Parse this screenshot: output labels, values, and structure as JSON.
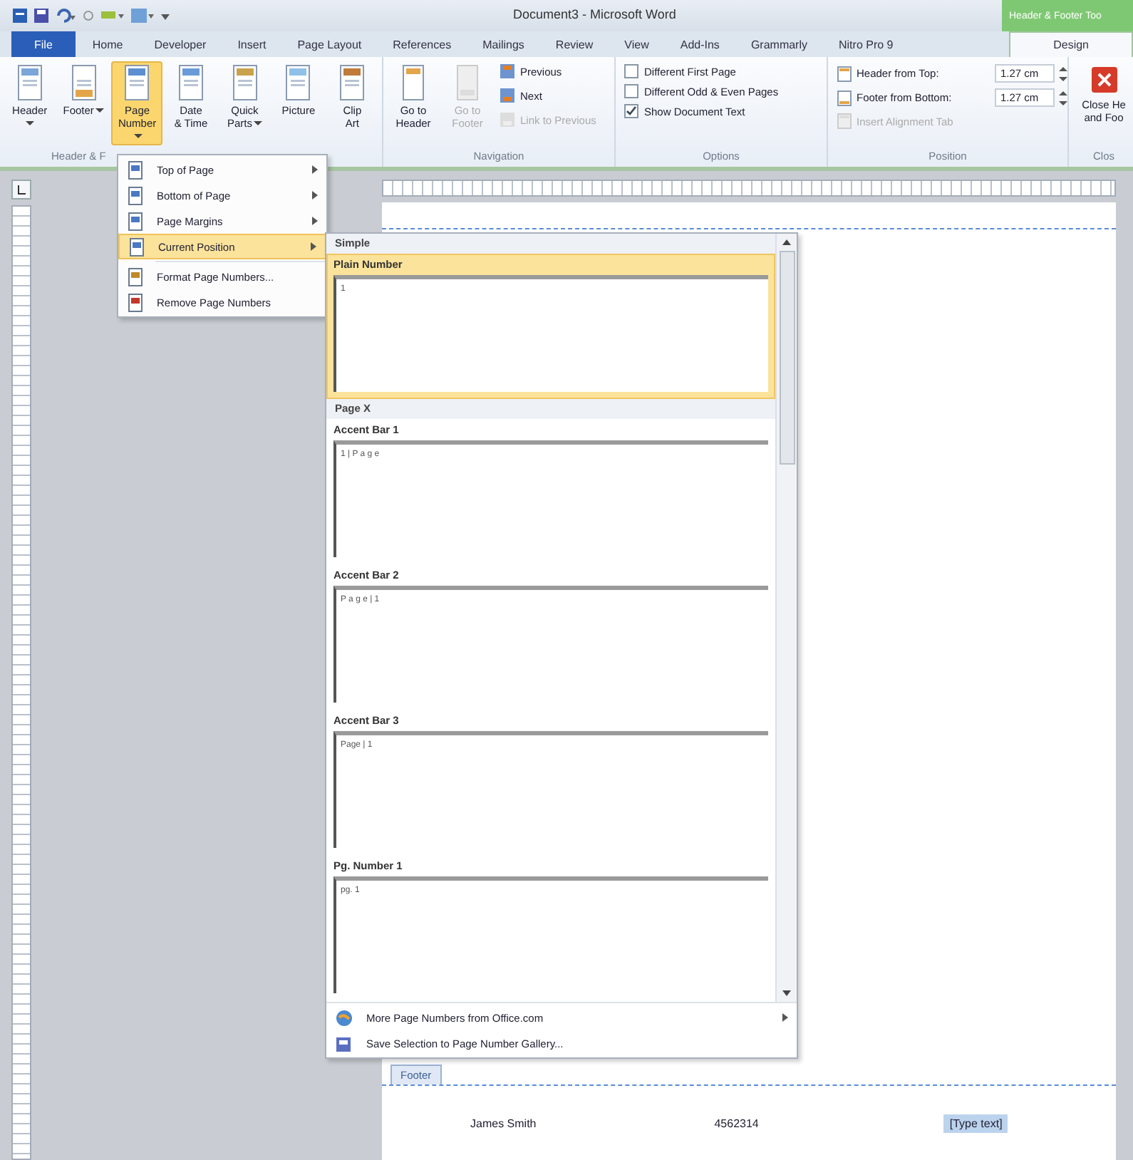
{
  "window": {
    "title": "Document3 - Microsoft Word",
    "contextual_tab": "Header & Footer Too"
  },
  "tabs": [
    {
      "label": "File",
      "kind": "file",
      "selected": false
    },
    {
      "label": "Home",
      "kind": "tab",
      "selected": false
    },
    {
      "label": "Developer",
      "kind": "tab",
      "selected": false
    },
    {
      "label": "Insert",
      "kind": "tab",
      "selected": false
    },
    {
      "label": "Page Layout",
      "kind": "tab",
      "selected": false
    },
    {
      "label": "References",
      "kind": "tab",
      "selected": false
    },
    {
      "label": "Mailings",
      "kind": "tab",
      "selected": false
    },
    {
      "label": "Review",
      "kind": "tab",
      "selected": false
    },
    {
      "label": "View",
      "kind": "tab",
      "selected": false
    },
    {
      "label": "Add-Ins",
      "kind": "tab",
      "selected": false
    },
    {
      "label": "Grammarly",
      "kind": "tab",
      "selected": false
    },
    {
      "label": "Nitro Pro 9",
      "kind": "tab",
      "selected": false
    },
    {
      "label": "Design",
      "kind": "contextual",
      "selected": true
    }
  ],
  "ribbon": {
    "header_footer": {
      "label": "Header & F",
      "buttons": [
        {
          "label": "Header",
          "dropdown": true,
          "selected": false
        },
        {
          "label": "Footer",
          "dropdown": true,
          "selected": false
        },
        {
          "label": "Page\nNumber",
          "dropdown": true,
          "selected": true
        },
        {
          "label": "Date\n& Time",
          "dropdown": false,
          "selected": false
        },
        {
          "label": "Quick\nParts",
          "dropdown": true,
          "selected": false
        },
        {
          "label": "Picture",
          "dropdown": false,
          "selected": false
        },
        {
          "label": "Clip\nArt",
          "dropdown": false,
          "selected": false
        }
      ]
    },
    "navigation": {
      "label": "Navigation",
      "big_buttons": [
        {
          "label": "Go to\nHeader",
          "disabled": false
        },
        {
          "label": "Go to\nFooter",
          "disabled": true
        }
      ],
      "small_buttons": [
        {
          "label": "Previous",
          "disabled": false
        },
        {
          "label": "Next",
          "disabled": false
        },
        {
          "label": "Link to Previous",
          "disabled": true
        }
      ]
    },
    "options": {
      "label": "Options",
      "checkboxes": [
        {
          "label": "Different First Page",
          "checked": false
        },
        {
          "label": "Different Odd & Even Pages",
          "checked": false
        },
        {
          "label": "Show Document Text",
          "checked": true
        }
      ]
    },
    "position": {
      "label": "Position",
      "rows": [
        {
          "label": "Header from Top:",
          "value": "1.27 cm",
          "disabled": false
        },
        {
          "label": "Footer from Bottom:",
          "value": "1.27 cm",
          "disabled": false
        },
        {
          "label": "Insert Alignment Tab",
          "disabled": true
        }
      ]
    },
    "close": {
      "label": "Clos",
      "button": "Close He\nand Foo"
    }
  },
  "page_number_menu": {
    "groups": [
      [
        {
          "label": "Top of Page",
          "submenu": true,
          "selected": false
        },
        {
          "label": "Bottom of Page",
          "submenu": true,
          "selected": false
        },
        {
          "label": "Page Margins",
          "submenu": true,
          "selected": false
        },
        {
          "label": "Current Position",
          "submenu": true,
          "selected": true
        }
      ],
      [
        {
          "label": "Format Page Numbers...",
          "submenu": false,
          "selected": false
        },
        {
          "label": "Remove Page Numbers",
          "submenu": false,
          "selected": false
        }
      ]
    ]
  },
  "gallery": {
    "sections": [
      {
        "heading": "Simple",
        "items": [
          {
            "label": "Plain Number",
            "preview": "1",
            "selected": true
          }
        ]
      },
      {
        "heading": "Page X",
        "items": [
          {
            "label": "Accent Bar 1",
            "preview": "1 | P a g e",
            "selected": false
          },
          {
            "label": "Accent Bar 2",
            "preview": "P a g e | 1",
            "selected": false
          },
          {
            "label": "Accent Bar 3",
            "preview": "Page | 1",
            "selected": false
          },
          {
            "label": "Pg. Number 1",
            "preview": "pg. 1",
            "selected": false
          }
        ]
      }
    ],
    "footer_items": [
      {
        "label": "More Page Numbers from Office.com",
        "submenu": true
      },
      {
        "label": "Save Selection to Page Number Gallery...",
        "submenu": false
      }
    ]
  },
  "document": {
    "footer_tab": "Footer",
    "footer_texts": [
      {
        "text": "James Smith",
        "highlighted": false
      },
      {
        "text": "4562314",
        "highlighted": false
      },
      {
        "text": "[Type text]",
        "highlighted": true
      }
    ]
  }
}
